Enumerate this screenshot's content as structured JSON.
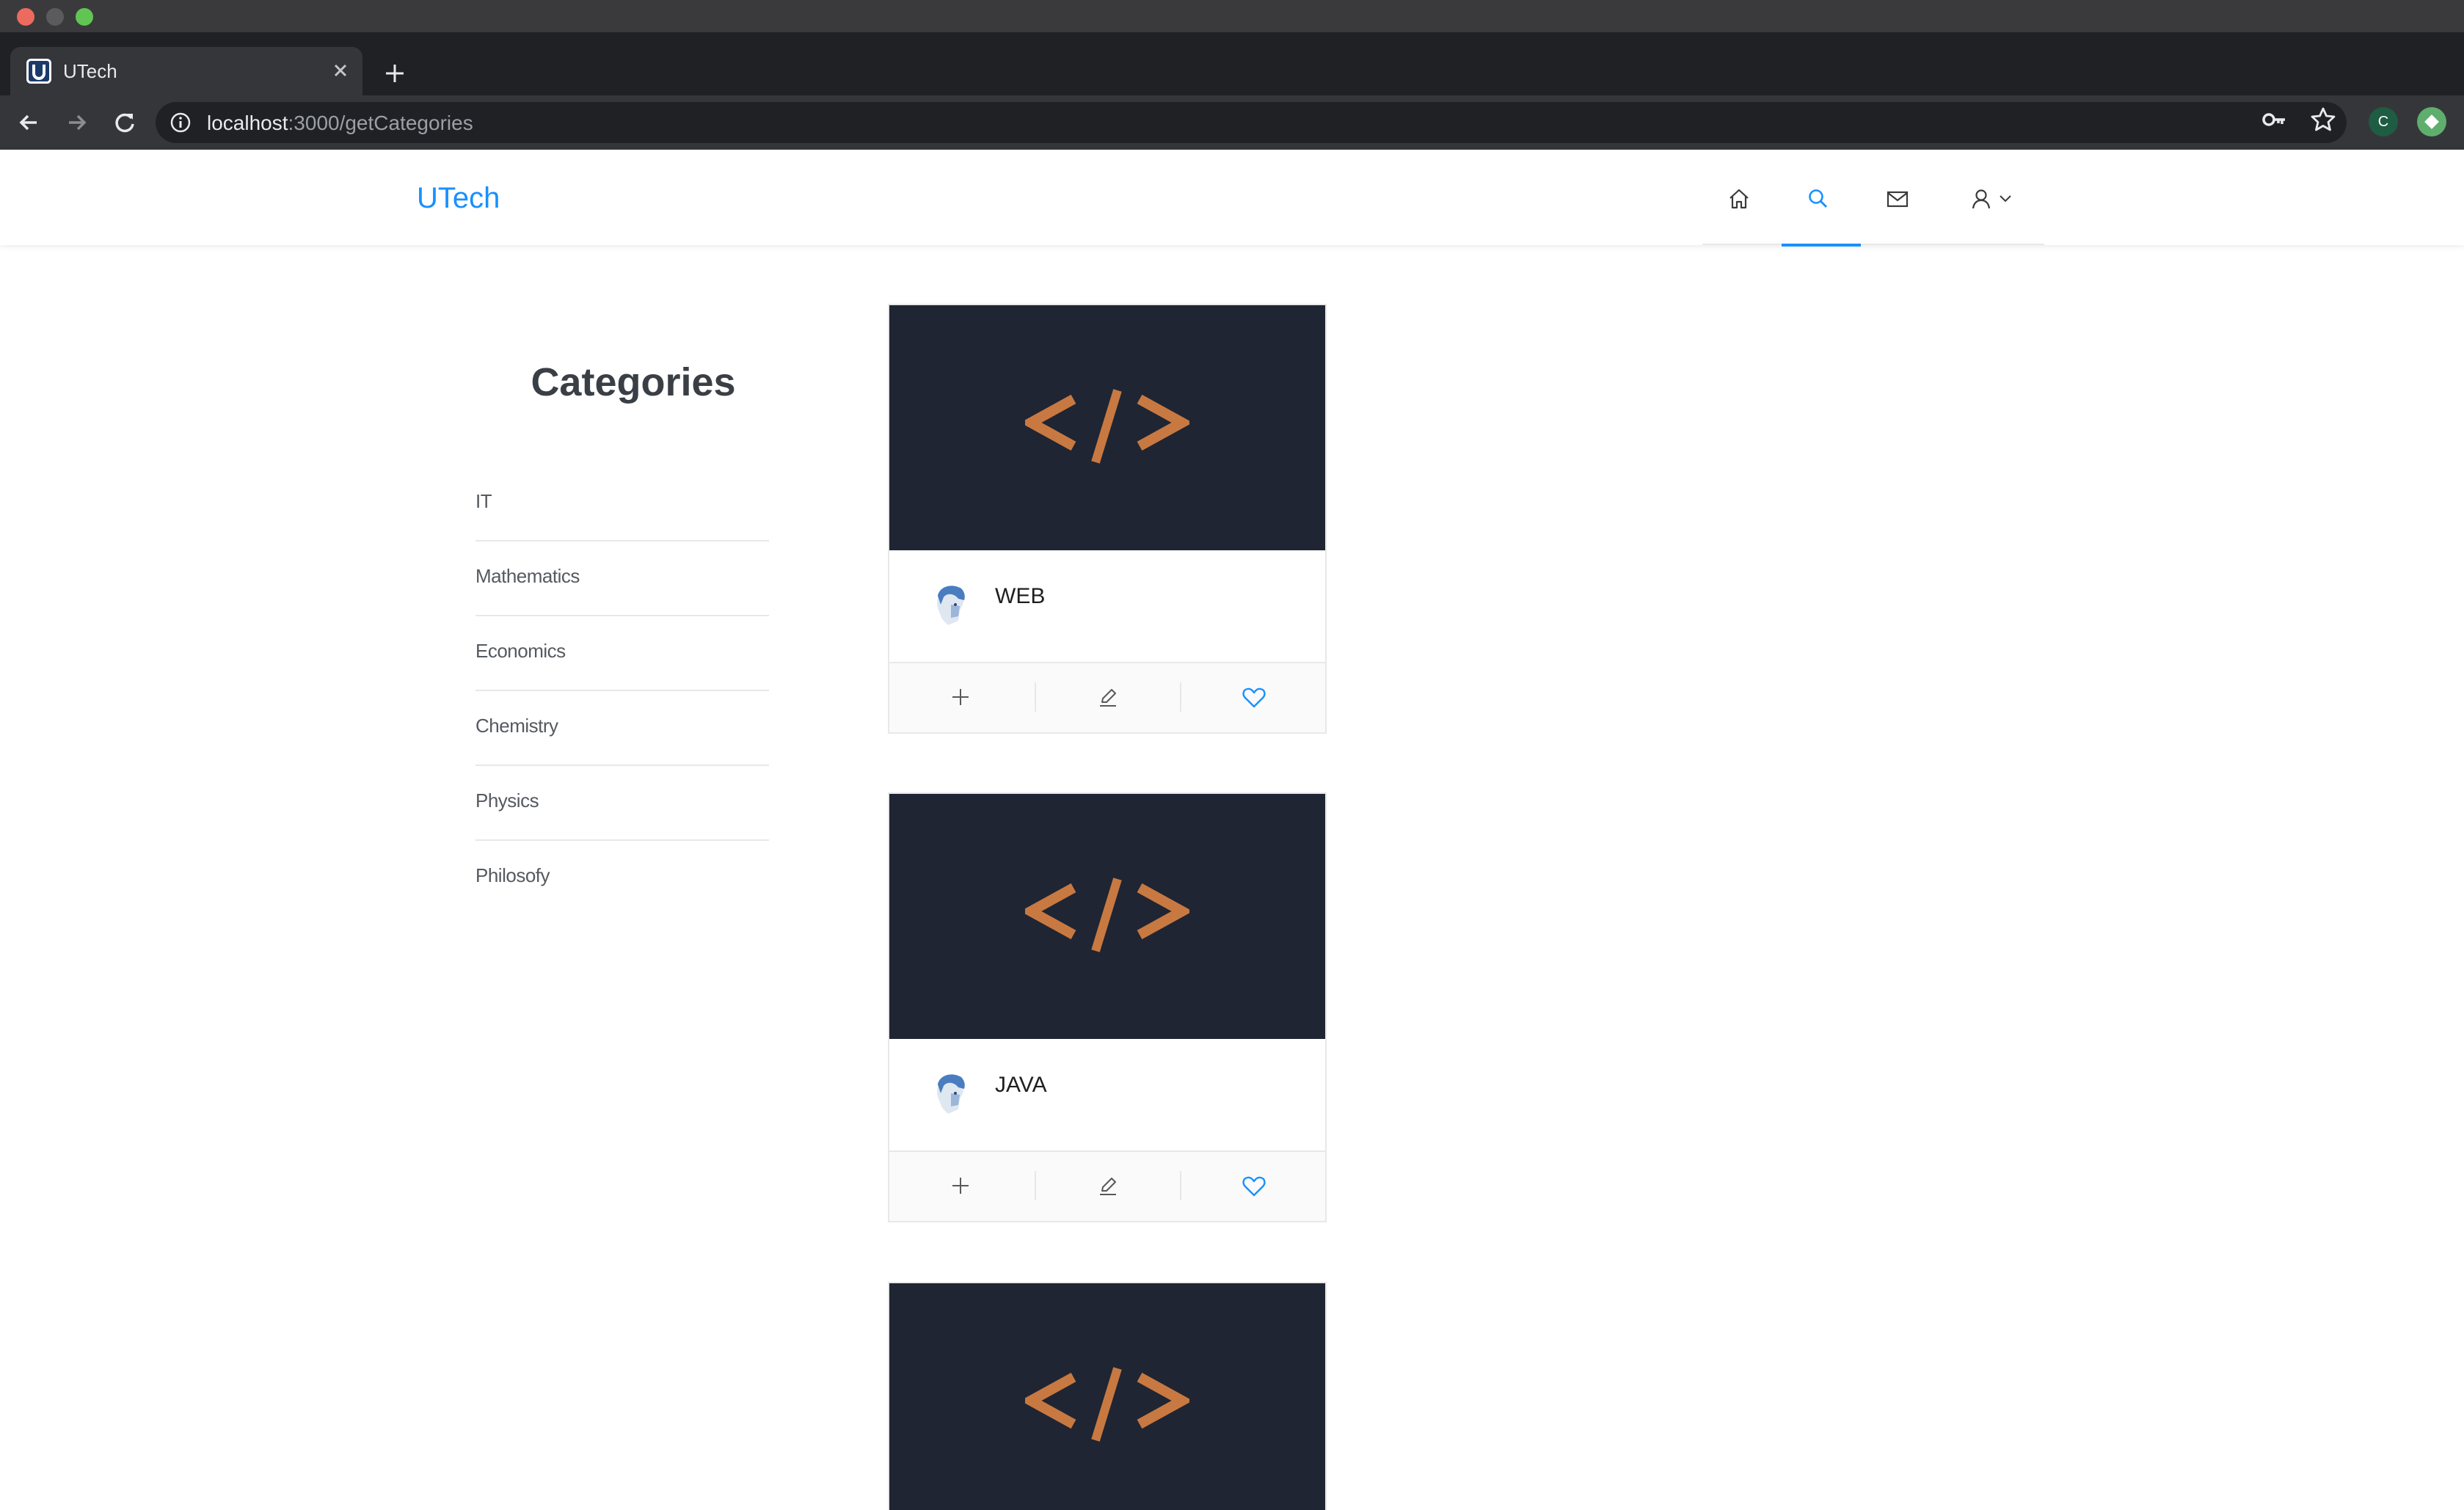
{
  "browser": {
    "tab_title": "UTech",
    "url_host": "localhost",
    "url_path": ":3000/getCategories",
    "extension_badge": "C"
  },
  "header": {
    "brand": "UTech",
    "menu": [
      "home-icon",
      "search-icon",
      "mail-icon",
      "user-icon"
    ],
    "active_menu": "search",
    "accent_color": "#1890ff"
  },
  "sidebar": {
    "title": "Categories",
    "items": [
      {
        "label": "IT"
      },
      {
        "label": "Mathematics"
      },
      {
        "label": "Economics"
      },
      {
        "label": "Chemistry"
      },
      {
        "label": "Physics"
      },
      {
        "label": "Philosofy"
      }
    ]
  },
  "cards": [
    {
      "title": "WEB",
      "cover_icon": "code-icon",
      "actions": [
        "plus-icon",
        "edit-icon",
        "heart-icon"
      ]
    },
    {
      "title": "JAVA",
      "cover_icon": "code-icon",
      "actions": [
        "plus-icon",
        "edit-icon",
        "heart-icon"
      ]
    },
    {
      "title": "",
      "cover_icon": "code-icon"
    }
  ],
  "colors": {
    "cover_bg": "#1f2533",
    "code_glyph": "#c87941",
    "heart": "#1890ff"
  }
}
